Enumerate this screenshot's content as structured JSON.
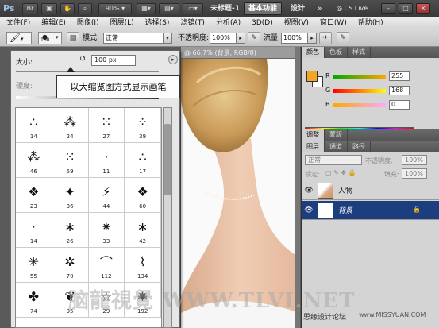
{
  "titlebar": {
    "app_logo": "Ps",
    "zoom": "90%",
    "doc_title": "未标题-1",
    "workspace_active": "基本功能",
    "workspace_design": "设计",
    "workspace_more": "»",
    "cs_live": "CS Live"
  },
  "menu": [
    "文件(F)",
    "编辑(E)",
    "图像(I)",
    "图层(L)",
    "选择(S)",
    "滤镜(T)",
    "分析(A)",
    "3D(D)",
    "视图(V)",
    "窗口(W)",
    "帮助(H)"
  ],
  "options": {
    "brush_size": "100",
    "mode_label": "模式:",
    "mode_value": "正常",
    "opacity_label": "不透明度:",
    "opacity_value": "100%",
    "flow_label": "流量:",
    "flow_value": "100%"
  },
  "brush_panel": {
    "size_label": "大小:",
    "size_value": "100 px",
    "hardness_label": "硬度:",
    "brushes": [
      {
        "num": "14",
        "glyph": "∴"
      },
      {
        "num": "24",
        "glyph": "⁂"
      },
      {
        "num": "27",
        "glyph": "⁙"
      },
      {
        "num": "39",
        "glyph": "⁘"
      },
      {
        "num": "46",
        "glyph": "⁂"
      },
      {
        "num": "59",
        "glyph": "⁙"
      },
      {
        "num": "11",
        "glyph": "·"
      },
      {
        "num": "17",
        "glyph": "∴"
      },
      {
        "num": "23",
        "glyph": "❖"
      },
      {
        "num": "36",
        "glyph": "✦"
      },
      {
        "num": "44",
        "glyph": "⚡"
      },
      {
        "num": "60",
        "glyph": "❖"
      },
      {
        "num": "14",
        "glyph": "·"
      },
      {
        "num": "26",
        "glyph": "∗"
      },
      {
        "num": "33",
        "glyph": "⁕"
      },
      {
        "num": "42",
        "glyph": "∗"
      },
      {
        "num": "55",
        "glyph": "✳"
      },
      {
        "num": "70",
        "glyph": "✲"
      },
      {
        "num": "112",
        "glyph": "⌒"
      },
      {
        "num": "134",
        "glyph": "⌇"
      },
      {
        "num": "74",
        "glyph": "✤"
      },
      {
        "num": "95",
        "glyph": "❦"
      },
      {
        "num": "29",
        "glyph": "☆"
      },
      {
        "num": "192",
        "glyph": "✺"
      }
    ]
  },
  "tooltip": "以大缩览图方式显示画笔",
  "document": {
    "tab_label": "@ 66.7% (背景, RGB/8)"
  },
  "color_panel": {
    "tabs": [
      "颜色",
      "色板",
      "样式"
    ],
    "fg_color": "#f5a623",
    "channels": [
      {
        "label": "R",
        "value": "255"
      },
      {
        "label": "G",
        "value": "168"
      },
      {
        "label": "B",
        "value": "0"
      }
    ]
  },
  "adjust_tabs": [
    "调整",
    "蒙版"
  ],
  "layers_panel": {
    "tabs": [
      "图层",
      "通道",
      "路径"
    ],
    "blend_mode": "正常",
    "opacity_label": "不透明度:",
    "opacity_value": "100%",
    "lock_label": "锁定:",
    "fill_label": "填充:",
    "fill_value": "100%",
    "layers": [
      {
        "name": "人物",
        "selected": false
      },
      {
        "name": "背景",
        "selected": true
      }
    ]
  },
  "watermark": "脑龍視覺 WWW.TLVI.NET",
  "site_text": "思缘设计论坛",
  "site_url": "www.MISSYUAN.COM"
}
